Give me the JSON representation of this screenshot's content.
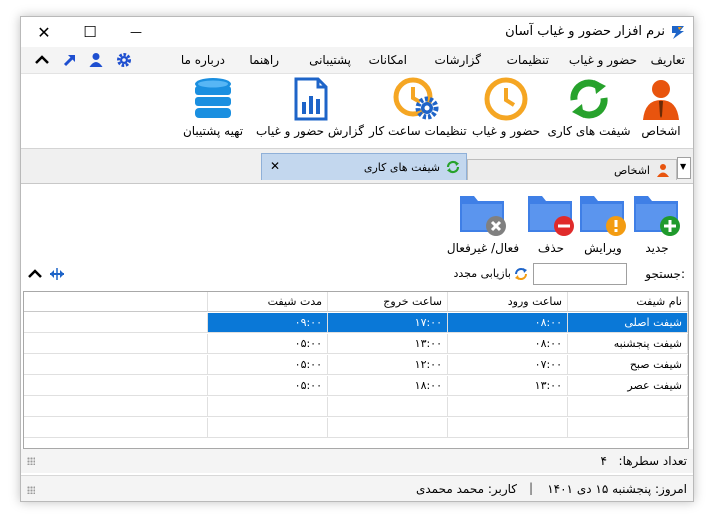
{
  "window": {
    "title": "نرم افزار حضور و غیاب آسان",
    "close_glyph": "✕",
    "max_glyph": "☐",
    "min_glyph": "—"
  },
  "menu": {
    "items": [
      "تعاریف",
      "حضور و غیاب",
      "تنظیمات",
      "گزارشات",
      "امکانات",
      "پشتیبانی",
      "راهنما",
      "درباره ما"
    ]
  },
  "ribbon": {
    "persons": "اشخاص",
    "shifts": "شیفت های کاری",
    "attendance": "حضور و غیاب",
    "clock_settings": "تنظیمات ساعت کار",
    "report": "گزارش حضور و غیاب",
    "backup": "تهیه پشتیبان"
  },
  "tabs": {
    "persons": "اشخاص",
    "shifts": "شیفت های کاری",
    "close_glyph": "✕",
    "dropdown_glyph": "▼"
  },
  "toolbar": {
    "new": "جدید",
    "edit": "ویرایش",
    "delete": "حذف",
    "toggle": "فعال/ غیرفعال"
  },
  "search": {
    "label": "جستجو:",
    "value": "",
    "reload": "بازیابی مجدد"
  },
  "grid": {
    "headers": [
      "نام شیفت",
      "ساعت ورود",
      "ساعت خروج",
      "مدت شیفت"
    ],
    "rows": [
      [
        "شیفت اصلی",
        "۰۸:۰۰",
        "۱۷:۰۰",
        "۰۹:۰۰"
      ],
      [
        "شیفت پنجشنبه",
        "۰۸:۰۰",
        "۱۳:۰۰",
        "۰۵:۰۰"
      ],
      [
        "شیفت صبح",
        "۰۷:۰۰",
        "۱۲:۰۰",
        "۰۵:۰۰"
      ],
      [
        "شیفت عصر",
        "۱۳:۰۰",
        "۱۸:۰۰",
        "۰۵:۰۰"
      ]
    ],
    "selected_row": 0
  },
  "rowcount": {
    "label": "تعداد سطرها:",
    "value": "۴"
  },
  "status": {
    "today": "امروز: پنجشنبه ۱۵ دی ۱۴۰۱",
    "separator": "|",
    "user": "کاربر: محمد محمدی"
  },
  "colors": {
    "accent": "#0a78d7",
    "brand_blue": "#1e64c8",
    "orange": "#f39c12",
    "green": "#27a22c",
    "folder": "#3f7fe6"
  }
}
